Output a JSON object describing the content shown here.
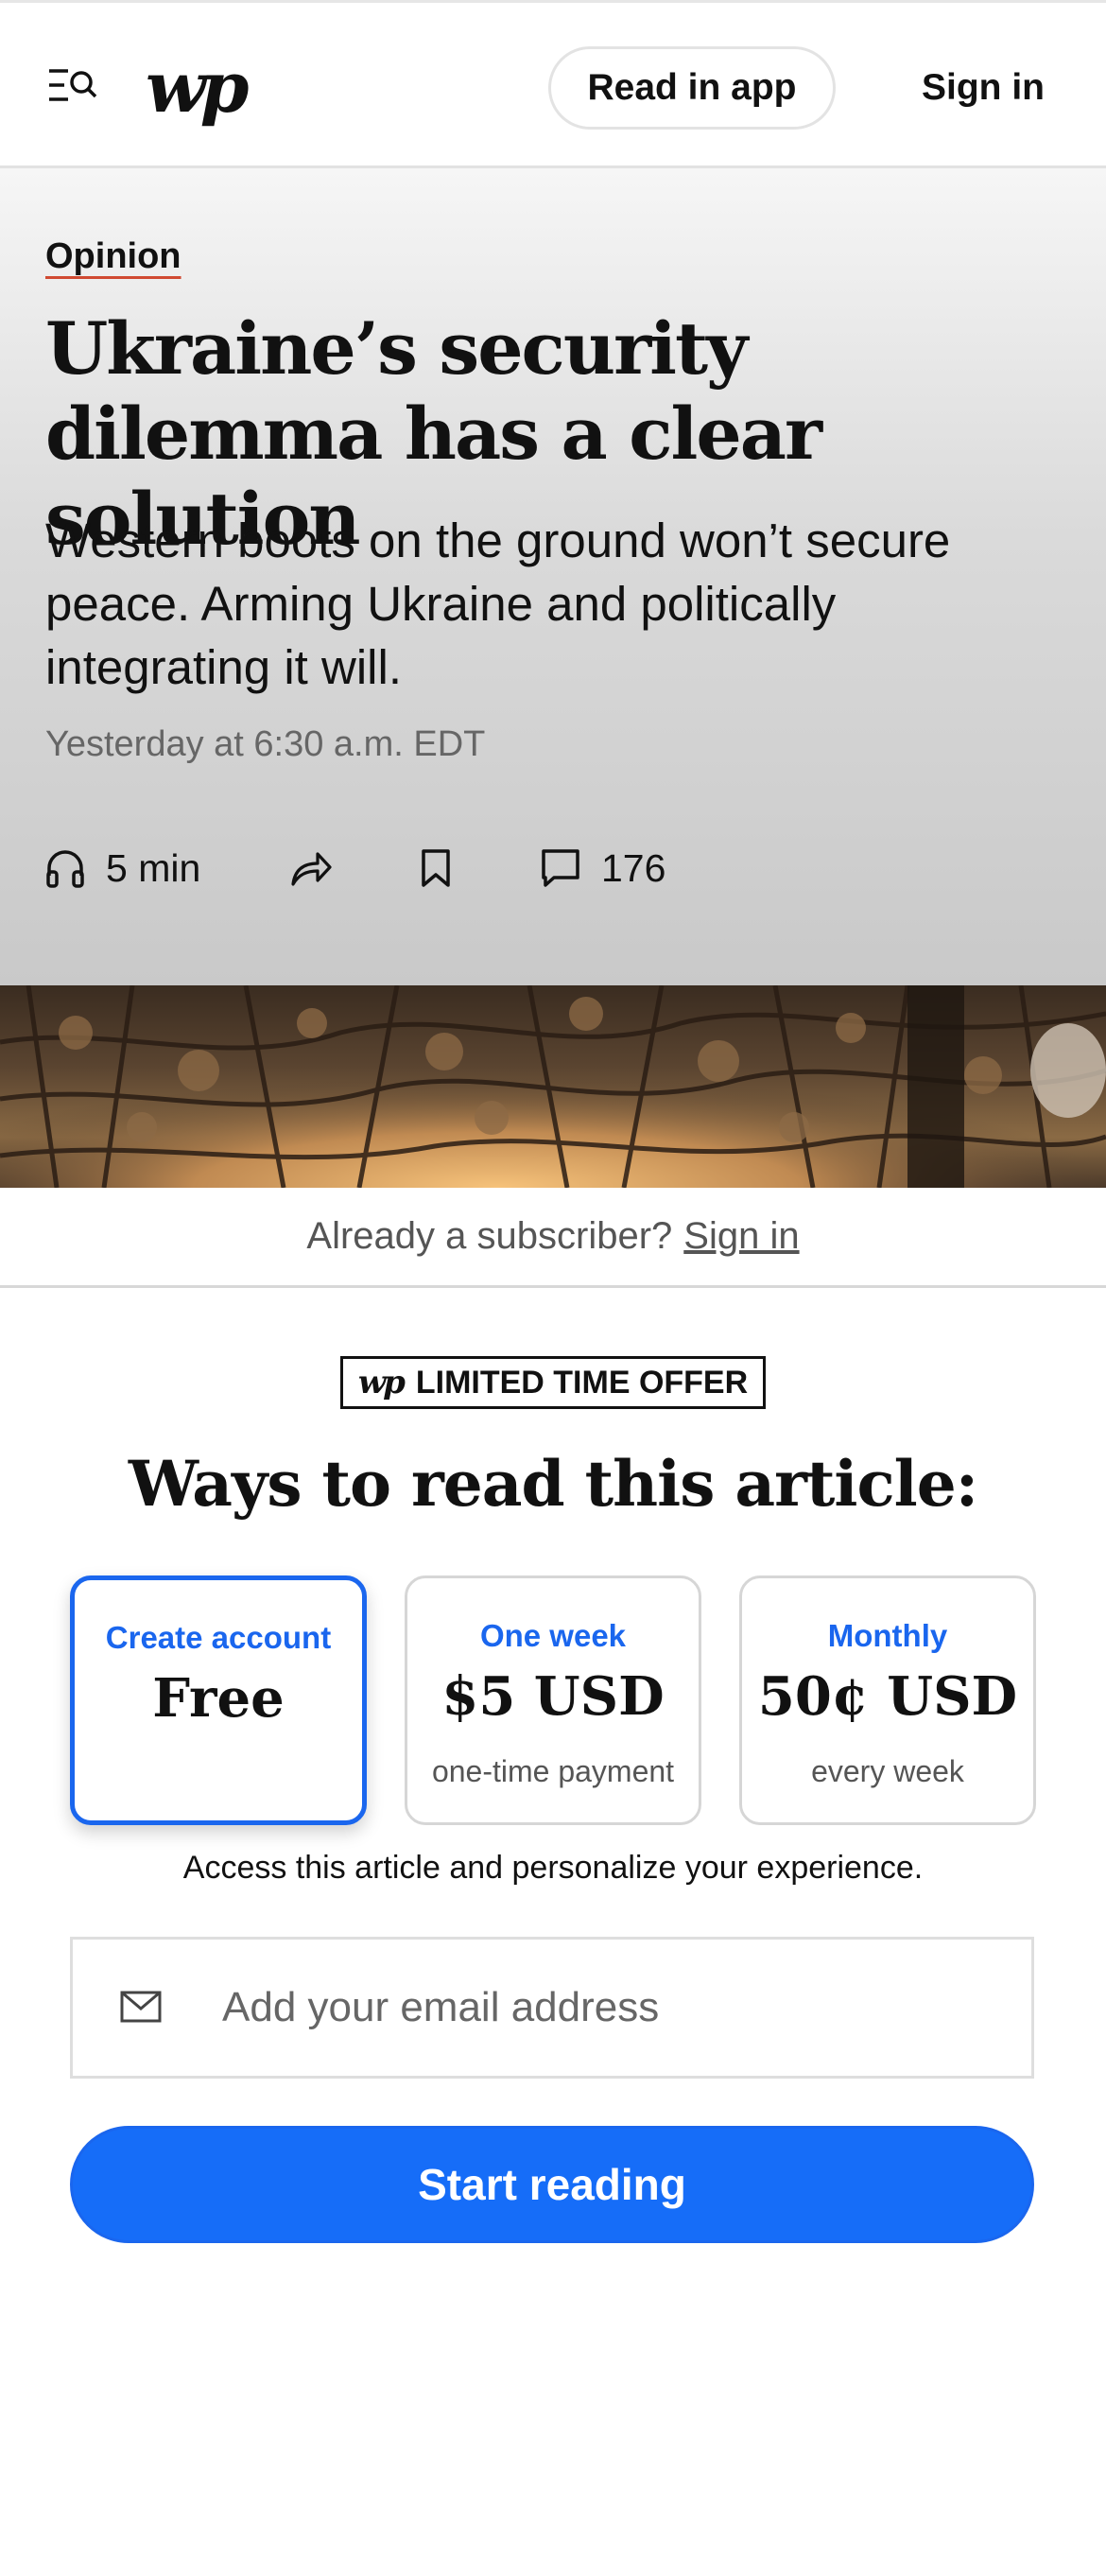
{
  "header": {
    "logo_text": "wp",
    "read_in_app_label": "Read in app",
    "sign_in_label": "Sign in"
  },
  "article": {
    "kicker": "Opinion",
    "headline": "Ukraine’s security dilemma has a clear solution",
    "dek": "Western boots on the ground won’t secure peace. Arming Ukraine and politically integrating it will.",
    "dateline": "Yesterday at 6:30 a.m. EDT",
    "actions": {
      "listen_label": "5 min",
      "comments_count": "176"
    }
  },
  "subscriber_bar": {
    "prompt": "Already a subscriber?",
    "link": "Sign in"
  },
  "offer": {
    "badge_mark": "wp",
    "badge_text": "LIMITED TIME OFFER",
    "title": "Ways to read this article:",
    "plans": [
      {
        "name": "Create account",
        "price": "Free",
        "note": "",
        "selected": true
      },
      {
        "name": "One week",
        "price": "$5 USD",
        "note": "one-time payment",
        "selected": false
      },
      {
        "name": "Monthly",
        "price": "50¢ USD",
        "note": "every week",
        "selected": false
      }
    ],
    "access_text": "Access this article and personalize your experience.",
    "email_placeholder": "Add your email address",
    "cta_label": "Start reading"
  },
  "colors": {
    "accent_blue": "#1a66ee",
    "button_blue": "#166df8",
    "kicker_underline": "#d04a32"
  }
}
